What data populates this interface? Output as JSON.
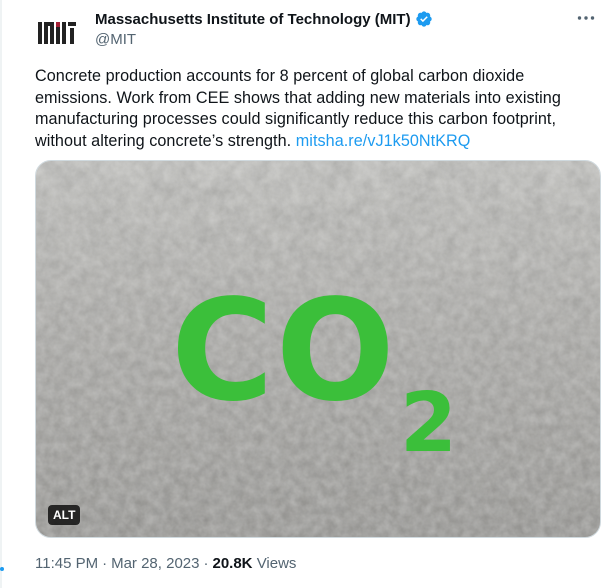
{
  "account": {
    "name": "Massachusetts Institute of Technology (MIT)",
    "handle": "@MIT",
    "verified": true,
    "avatar_icon": "mit-logo-icon"
  },
  "tweet": {
    "text": "Concrete production accounts for 8 percent of global carbon dioxide emissions. Work from CEE shows that adding new materials into existing manufacturing processes could significantly reduce this carbon footprint, without altering concrete’s strength.",
    "link_text": "mitsha.re/vJ1k50NtKRQ"
  },
  "media": {
    "overlay_text": "CO",
    "overlay_subscript": "2",
    "alt_label": "ALT"
  },
  "meta": {
    "time": "11:45 PM",
    "date": "Mar 28, 2023",
    "views_count": "20.8K",
    "views_label": "Views"
  },
  "colors": {
    "link": "#1d9bf0",
    "verified": "#1d9bf0",
    "co2_green": "#3bbf3a",
    "secondary_text": "#536471"
  }
}
